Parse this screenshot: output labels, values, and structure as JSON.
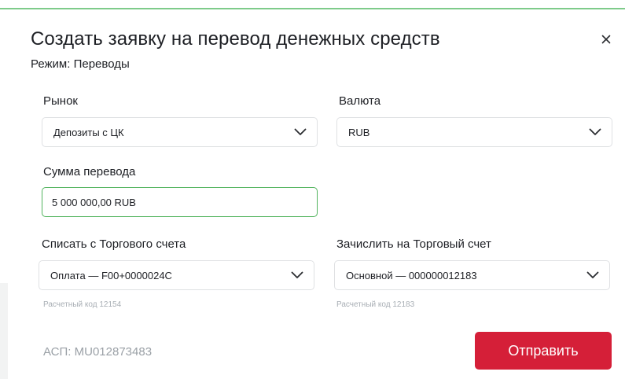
{
  "dialog": {
    "title": "Создать заявку на перевод денежных средств",
    "mode": "Режим: Переводы"
  },
  "form": {
    "market": {
      "label": "Рынок",
      "value": "Депозиты с ЦК"
    },
    "currency": {
      "label": "Валюта",
      "value": "RUB"
    },
    "amount": {
      "label": "Сумма перевода",
      "value": "5 000 000,00 RUB"
    },
    "debit": {
      "label": "Списать с Торгового счета",
      "value": "Оплата — F00+0000024C",
      "hint": "Расчетный код 12154"
    },
    "credit": {
      "label": "Зачислить на Торговый счет",
      "value": "Основной — 000000012183",
      "hint": "Расчетный код 12183"
    }
  },
  "footer": {
    "asp": "АСП: MU012873483",
    "submit_label": "Отправить"
  },
  "colors": {
    "accent_green": "#52b45e",
    "submit_red": "#d51f38"
  },
  "icons": [
    "close-icon",
    "chevron-down-icon"
  ]
}
